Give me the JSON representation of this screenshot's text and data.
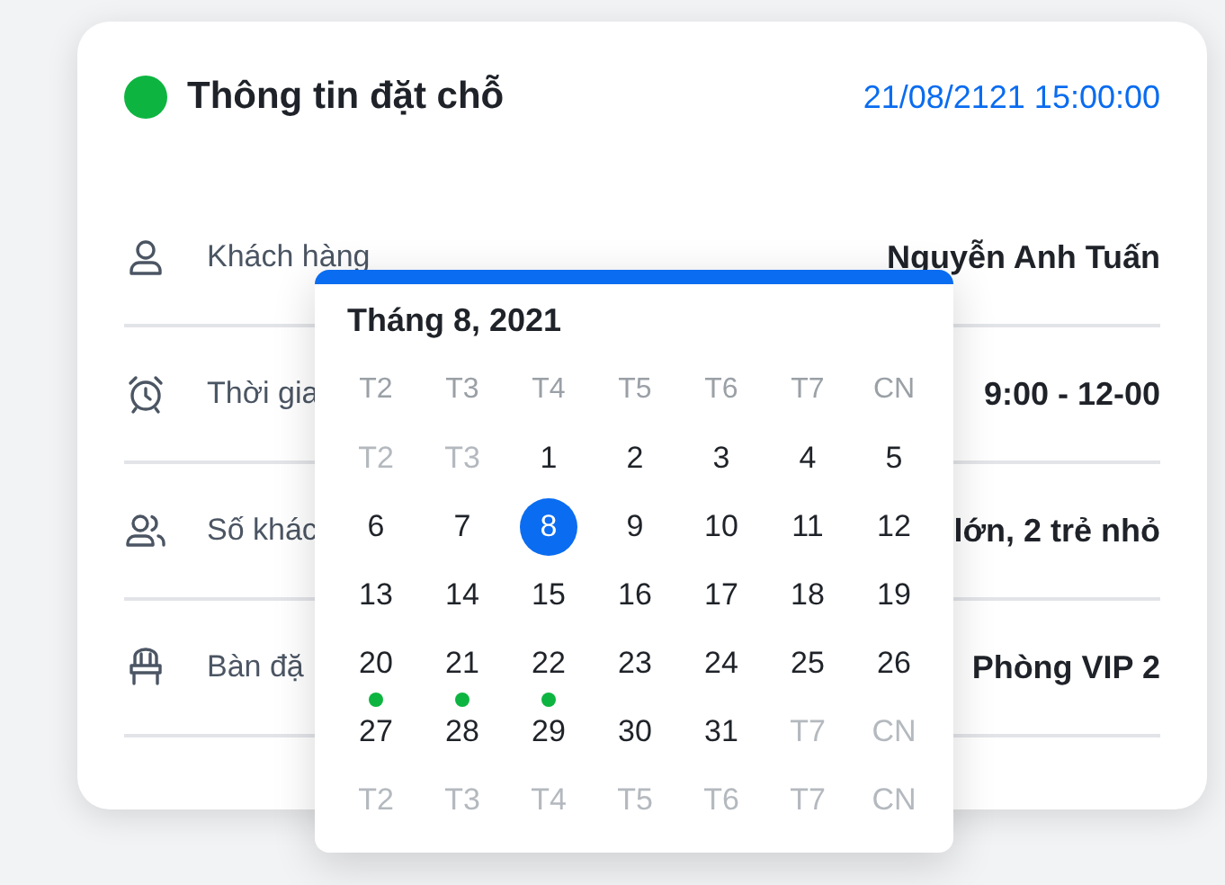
{
  "booking": {
    "title": "Thông tin đặt chỗ",
    "datetime": "21/08/2121 15:00:00",
    "rows": [
      {
        "kind": "customer",
        "label": "Khách hàng",
        "value": "Nguyễn Anh Tuấn"
      },
      {
        "kind": "time",
        "label": "Thời gia",
        "value": "9:00 - 12-00"
      },
      {
        "kind": "guests",
        "label": "Số khác",
        "value": "lớn, 2 trẻ nhỏ"
      },
      {
        "kind": "table",
        "label": "Bàn đặ",
        "value": "Phòng VIP 2"
      }
    ]
  },
  "calendar": {
    "title": "Tháng 8, 2021",
    "weekdays": [
      "T2",
      "T3",
      "T4",
      "T5",
      "T6",
      "T7",
      "CN"
    ],
    "weeks": [
      [
        {
          "text": "T2",
          "muted": true,
          "selected": false,
          "event": false
        },
        {
          "text": "T3",
          "muted": true,
          "selected": false,
          "event": false
        },
        {
          "text": "1",
          "muted": false,
          "selected": false,
          "event": false
        },
        {
          "text": "2",
          "muted": false,
          "selected": false,
          "event": false
        },
        {
          "text": "3",
          "muted": false,
          "selected": false,
          "event": false
        },
        {
          "text": "4",
          "muted": false,
          "selected": false,
          "event": false
        },
        {
          "text": "5",
          "muted": false,
          "selected": false,
          "event": false
        }
      ],
      [
        {
          "text": "6",
          "muted": false,
          "selected": false,
          "event": false
        },
        {
          "text": "7",
          "muted": false,
          "selected": false,
          "event": false
        },
        {
          "text": "8",
          "muted": false,
          "selected": true,
          "event": false
        },
        {
          "text": "9",
          "muted": false,
          "selected": false,
          "event": false
        },
        {
          "text": "10",
          "muted": false,
          "selected": false,
          "event": false
        },
        {
          "text": "11",
          "muted": false,
          "selected": false,
          "event": false
        },
        {
          "text": "12",
          "muted": false,
          "selected": false,
          "event": false
        }
      ],
      [
        {
          "text": "13",
          "muted": false,
          "selected": false,
          "event": false
        },
        {
          "text": "14",
          "muted": false,
          "selected": false,
          "event": false
        },
        {
          "text": "15",
          "muted": false,
          "selected": false,
          "event": false
        },
        {
          "text": "16",
          "muted": false,
          "selected": false,
          "event": false
        },
        {
          "text": "17",
          "muted": false,
          "selected": false,
          "event": false
        },
        {
          "text": "18",
          "muted": false,
          "selected": false,
          "event": false
        },
        {
          "text": "19",
          "muted": false,
          "selected": false,
          "event": false
        }
      ],
      [
        {
          "text": "20",
          "muted": false,
          "selected": false,
          "event": true
        },
        {
          "text": "21",
          "muted": false,
          "selected": false,
          "event": true
        },
        {
          "text": "22",
          "muted": false,
          "selected": false,
          "event": true
        },
        {
          "text": "23",
          "muted": false,
          "selected": false,
          "event": false
        },
        {
          "text": "24",
          "muted": false,
          "selected": false,
          "event": false
        },
        {
          "text": "25",
          "muted": false,
          "selected": false,
          "event": false
        },
        {
          "text": "26",
          "muted": false,
          "selected": false,
          "event": false
        }
      ],
      [
        {
          "text": "27",
          "muted": false,
          "selected": false,
          "event": false
        },
        {
          "text": "28",
          "muted": false,
          "selected": false,
          "event": false
        },
        {
          "text": "29",
          "muted": false,
          "selected": false,
          "event": false
        },
        {
          "text": "30",
          "muted": false,
          "selected": false,
          "event": false
        },
        {
          "text": "31",
          "muted": false,
          "selected": false,
          "event": false
        },
        {
          "text": "T7",
          "muted": true,
          "selected": false,
          "event": false
        },
        {
          "text": "CN",
          "muted": true,
          "selected": false,
          "event": false
        }
      ],
      [
        {
          "text": "T2",
          "muted": true,
          "selected": false,
          "event": false
        },
        {
          "text": "T3",
          "muted": true,
          "selected": false,
          "event": false
        },
        {
          "text": "T4",
          "muted": true,
          "selected": false,
          "event": false
        },
        {
          "text": "T5",
          "muted": true,
          "selected": false,
          "event": false
        },
        {
          "text": "T6",
          "muted": true,
          "selected": false,
          "event": false
        },
        {
          "text": "T7",
          "muted": true,
          "selected": false,
          "event": false
        },
        {
          "text": "CN",
          "muted": true,
          "selected": false,
          "event": false
        }
      ]
    ]
  }
}
